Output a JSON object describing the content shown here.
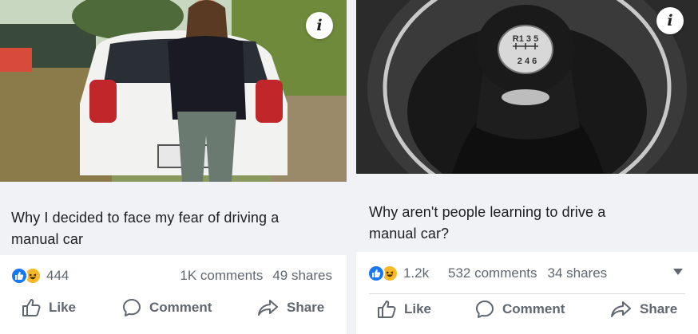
{
  "posts": [
    {
      "headline_line1": "Why I decided to face my fear of driving a",
      "headline_line2": "manual car",
      "info_icon": "i",
      "reaction_icons": [
        "like-icon",
        "haha-icon"
      ],
      "reaction_count": "444",
      "comments": "1K comments",
      "shares": "49 shares",
      "actions": {
        "like": "Like",
        "comment": "Comment",
        "share": "Share"
      }
    },
    {
      "headline_line1": "Why aren't people learning to drive a",
      "headline_line2": "manual car?",
      "info_icon": "i",
      "reaction_icons": [
        "like-icon",
        "haha-icon"
      ],
      "reaction_count": "1.2k",
      "comments": "532 comments",
      "shares": "34 shares",
      "shift_knob_top": "R1 3 5",
      "shift_knob_bottom": "2 4 6",
      "actions": {
        "like": "Like",
        "comment": "Comment",
        "share": "Share"
      }
    }
  ],
  "colors": {
    "facebook_blue": "#1877f2",
    "haha_yellow": "#f7b928",
    "meta_text": "#606770",
    "headline_bg": "#f0f2f5"
  }
}
